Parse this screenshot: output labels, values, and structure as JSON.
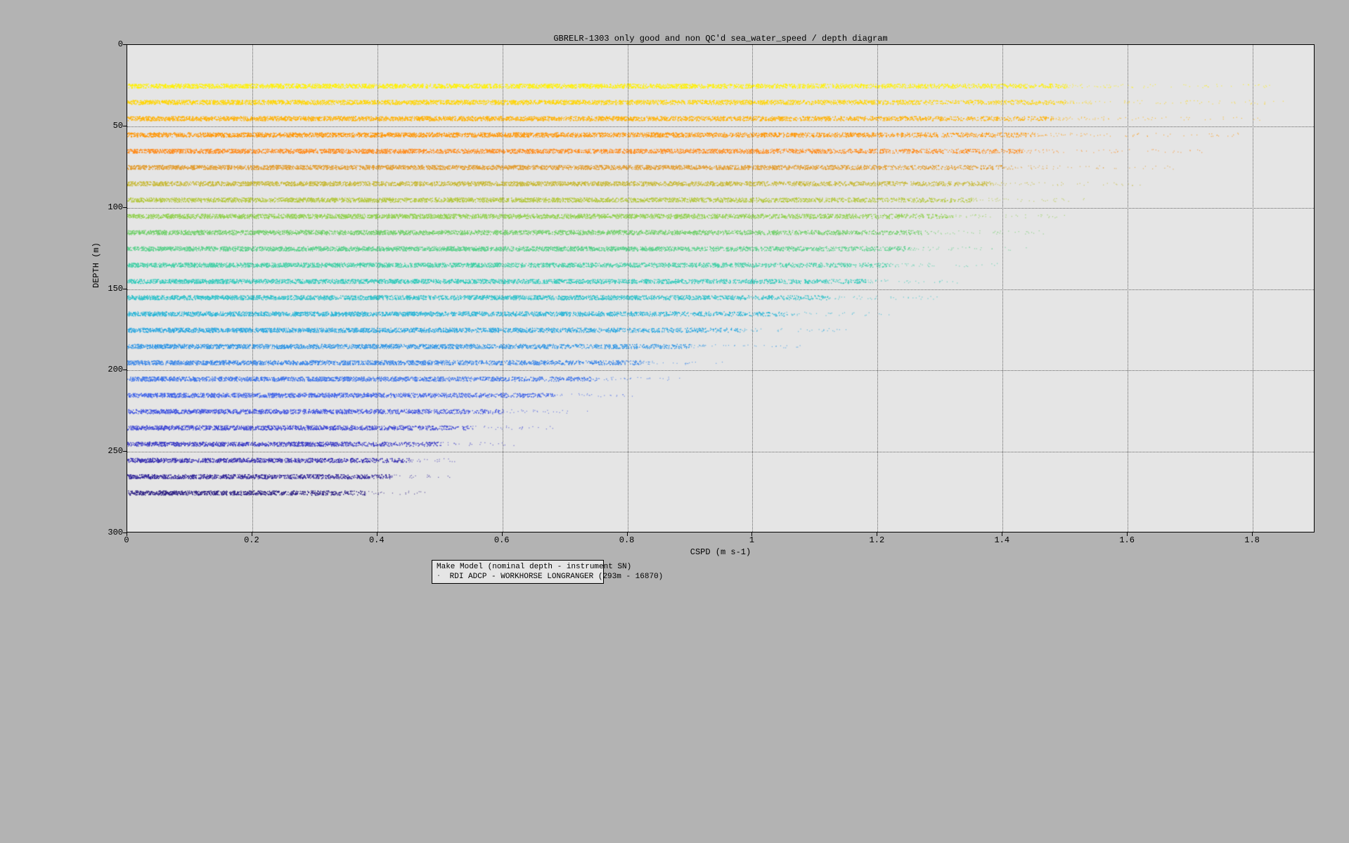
{
  "chart_data": {
    "type": "scatter",
    "title": "GBRELR-1303 only good and non QC'd sea_water_speed / depth diagram",
    "xlabel": "CSPD (m s-1)",
    "ylabel": "DEPTH (m)",
    "xlim": [
      0,
      1.9
    ],
    "ylim": [
      300,
      0
    ],
    "x_ticks": [
      0,
      0.2,
      0.4,
      0.6,
      0.8,
      1.0,
      1.2,
      1.4,
      1.6,
      1.8
    ],
    "y_ticks": [
      0,
      50,
      100,
      150,
      200,
      250,
      300
    ],
    "series": [
      {
        "depth": 25,
        "x_extent_main": [
          0.0,
          1.5
        ],
        "x_extent_sparse": [
          1.5,
          1.85
        ],
        "color": "#fff000"
      },
      {
        "depth": 35,
        "x_extent_main": [
          0.0,
          1.5
        ],
        "x_extent_sparse": [
          1.5,
          1.85
        ],
        "color": "#ffd400"
      },
      {
        "depth": 45,
        "x_extent_main": [
          0.0,
          1.48
        ],
        "x_extent_sparse": [
          1.48,
          1.82
        ],
        "color": "#ffb000"
      },
      {
        "depth": 55,
        "x_extent_main": [
          0.0,
          1.45
        ],
        "x_extent_sparse": [
          1.45,
          1.78
        ],
        "color": "#ff9500"
      },
      {
        "depth": 65,
        "x_extent_main": [
          0.0,
          1.43
        ],
        "x_extent_sparse": [
          1.43,
          1.72
        ],
        "color": "#ff8a1a"
      },
      {
        "depth": 75,
        "x_extent_main": [
          0.0,
          1.4
        ],
        "x_extent_sparse": [
          1.4,
          1.68
        ],
        "color": "#e29a2a"
      },
      {
        "depth": 85,
        "x_extent_main": [
          0.0,
          1.38
        ],
        "x_extent_sparse": [
          1.38,
          1.62
        ],
        "color": "#c6b732"
      },
      {
        "depth": 95,
        "x_extent_main": [
          0.0,
          1.35
        ],
        "x_extent_sparse": [
          1.35,
          1.55
        ],
        "color": "#b2c63a"
      },
      {
        "depth": 105,
        "x_extent_main": [
          0.0,
          1.32
        ],
        "x_extent_sparse": [
          1.32,
          1.5
        ],
        "color": "#8ecf4a"
      },
      {
        "depth": 115,
        "x_extent_main": [
          0.0,
          1.28
        ],
        "x_extent_sparse": [
          1.28,
          1.48
        ],
        "color": "#6fcf68"
      },
      {
        "depth": 125,
        "x_extent_main": [
          0.0,
          1.25
        ],
        "x_extent_sparse": [
          1.25,
          1.44
        ],
        "color": "#55cf88"
      },
      {
        "depth": 135,
        "x_extent_main": [
          0.0,
          1.22
        ],
        "x_extent_sparse": [
          1.22,
          1.4
        ],
        "color": "#40cfa5"
      },
      {
        "depth": 145,
        "x_extent_main": [
          0.0,
          1.18
        ],
        "x_extent_sparse": [
          1.18,
          1.35
        ],
        "color": "#30cabb"
      },
      {
        "depth": 155,
        "x_extent_main": [
          0.0,
          1.12
        ],
        "x_extent_sparse": [
          1.12,
          1.3
        ],
        "color": "#2ac0c9"
      },
      {
        "depth": 165,
        "x_extent_main": [
          0.0,
          1.05
        ],
        "x_extent_sparse": [
          1.05,
          1.22
        ],
        "color": "#26b4d6"
      },
      {
        "depth": 175,
        "x_extent_main": [
          0.0,
          0.98
        ],
        "x_extent_sparse": [
          0.98,
          1.15
        ],
        "color": "#28a6e0"
      },
      {
        "depth": 185,
        "x_extent_main": [
          0.0,
          0.9
        ],
        "x_extent_sparse": [
          0.9,
          1.08
        ],
        "color": "#2e95e5"
      },
      {
        "depth": 195,
        "x_extent_main": [
          0.0,
          0.82
        ],
        "x_extent_sparse": [
          0.82,
          0.98
        ],
        "color": "#3684e8"
      },
      {
        "depth": 205,
        "x_extent_main": [
          0.0,
          0.75
        ],
        "x_extent_sparse": [
          0.75,
          0.9
        ],
        "color": "#3c73ea"
      },
      {
        "depth": 215,
        "x_extent_main": [
          0.0,
          0.68
        ],
        "x_extent_sparse": [
          0.68,
          0.82
        ],
        "color": "#3e62e8"
      },
      {
        "depth": 225,
        "x_extent_main": [
          0.0,
          0.6
        ],
        "x_extent_sparse": [
          0.6,
          0.74
        ],
        "color": "#3e52e0"
      },
      {
        "depth": 235,
        "x_extent_main": [
          0.0,
          0.55
        ],
        "x_extent_sparse": [
          0.55,
          0.68
        ],
        "color": "#3a44d4"
      },
      {
        "depth": 245,
        "x_extent_main": [
          0.0,
          0.5
        ],
        "x_extent_sparse": [
          0.5,
          0.62
        ],
        "color": "#3838c4"
      },
      {
        "depth": 255,
        "x_extent_main": [
          0.0,
          0.45
        ],
        "x_extent_sparse": [
          0.45,
          0.56
        ],
        "color": "#342cb0"
      },
      {
        "depth": 265,
        "x_extent_main": [
          0.0,
          0.42
        ],
        "x_extent_sparse": [
          0.42,
          0.52
        ],
        "color": "#2e2298"
      },
      {
        "depth": 275,
        "x_extent_main": [
          0.0,
          0.38
        ],
        "x_extent_sparse": [
          0.38,
          0.48
        ],
        "color": "#281a80"
      }
    ],
    "legend": {
      "title": "Make Model (nominal depth - instrument SN)",
      "entries": [
        {
          "marker": "·",
          "label": " RDI ADCP - WORKHORSE LONGRANGER (293m - 16870)"
        }
      ]
    }
  }
}
